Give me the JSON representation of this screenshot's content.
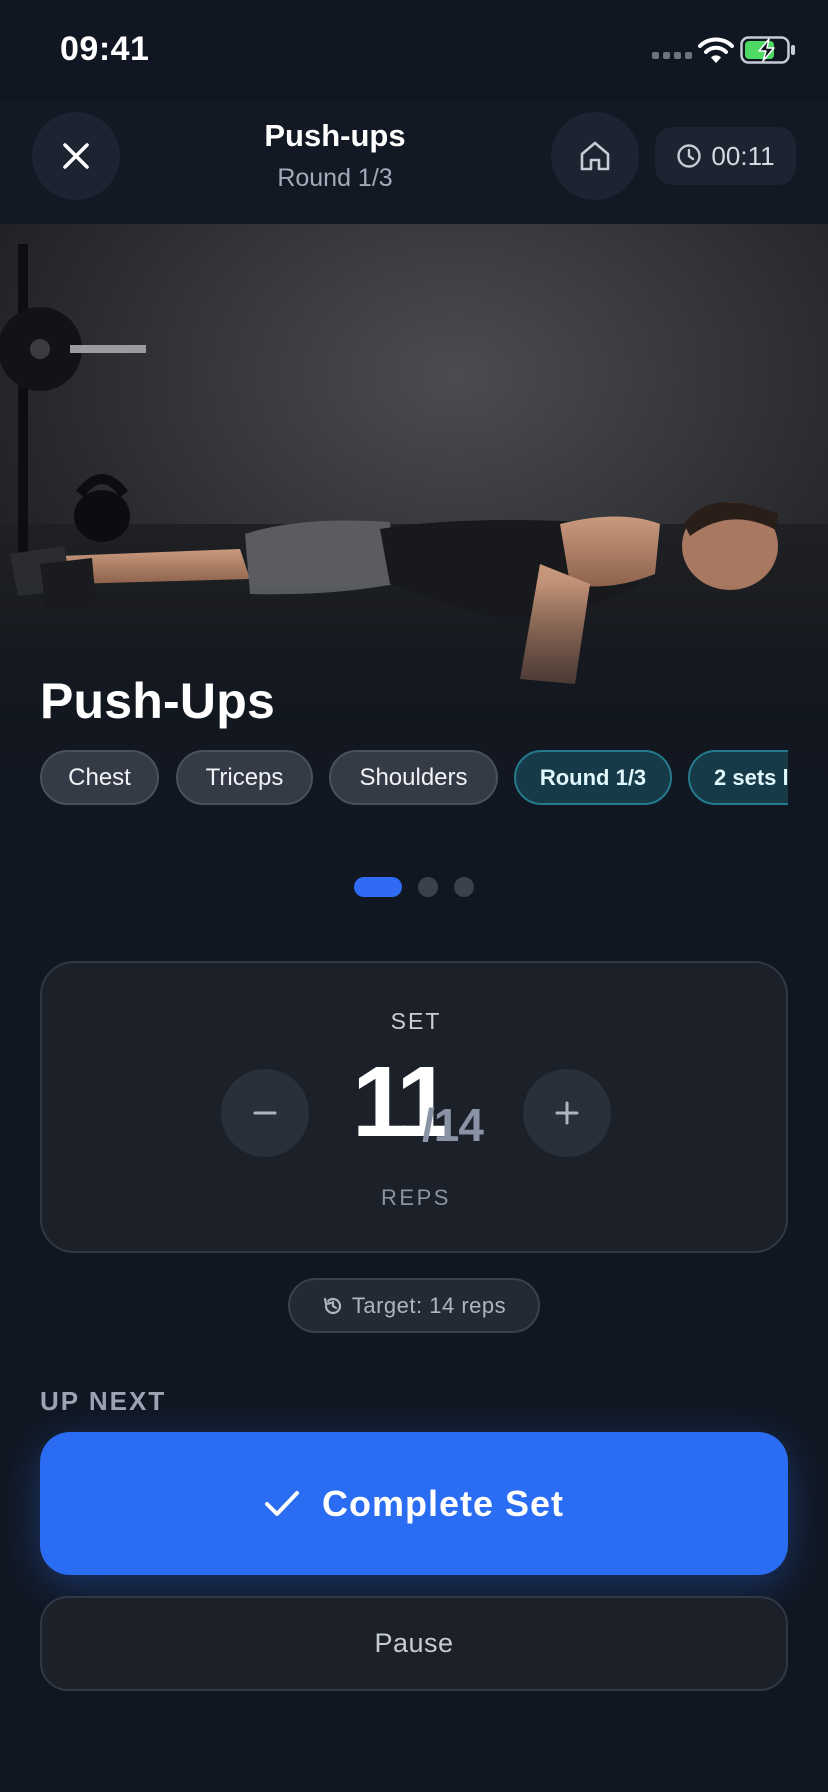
{
  "status_bar": {
    "time": "09:41",
    "icons": [
      "cellular-signal-icon",
      "wifi-icon",
      "battery-charging-icon"
    ],
    "battery_color": "#4cd964"
  },
  "header": {
    "title": "Push-ups",
    "subtitle": "Round 1/3",
    "timer": "00:11",
    "icons": [
      "close-icon",
      "home-icon",
      "clock-icon"
    ]
  },
  "hero": {
    "title": "Push-Ups",
    "image": "photo of a man doing a push-up in a dark gym",
    "tags": [
      {
        "label": "Chest",
        "style": "muscle"
      },
      {
        "label": "Triceps",
        "style": "muscle"
      },
      {
        "label": "Shoulders",
        "style": "muscle"
      },
      {
        "label": "Round 1/3",
        "style": "accent"
      },
      {
        "label": "2 sets l",
        "style": "accent"
      }
    ]
  },
  "pager": {
    "total": 3,
    "active": 1
  },
  "set_card": {
    "label": "SET",
    "current_reps": "11",
    "target_fraction": "/14",
    "unit": "REPS"
  },
  "target": {
    "text": "Target: 14 reps",
    "icon": "history-icon"
  },
  "up_next": {
    "label": "UP NEXT"
  },
  "actions": {
    "complete": "Complete Set",
    "complete_icon": "checkmark-icon",
    "pause": "Pause"
  },
  "colors": {
    "background": "#111722",
    "card": "#1b2029",
    "accent": "#2a6cf2",
    "teal_tag": "#173a48"
  }
}
